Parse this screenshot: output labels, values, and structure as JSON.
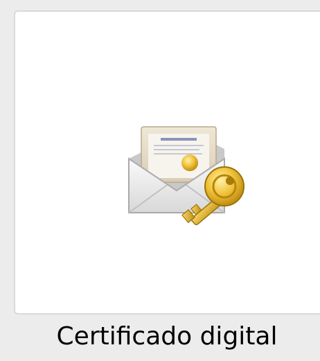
{
  "item": {
    "label": "Certificado digital",
    "icon": "envelope-certificate-key-icon"
  },
  "colors": {
    "background": "#ececec",
    "tile_background": "#ffffff",
    "tile_border": "#d9d9d9",
    "key_gold": "#e6b21e",
    "envelope": "#f2f2f2"
  }
}
